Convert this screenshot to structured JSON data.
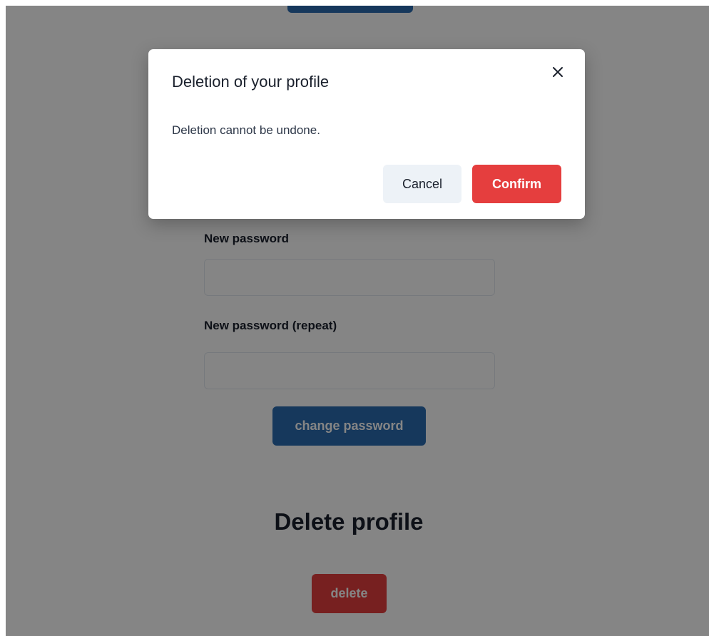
{
  "page": {
    "password_label": "New password",
    "password_repeat_label": "New password (repeat)",
    "change_password_label": "change password",
    "delete_section_title": "Delete profile",
    "delete_label": "delete"
  },
  "modal": {
    "title": "Deletion of your profile",
    "body": "Deletion cannot be undone.",
    "cancel_label": "Cancel",
    "confirm_label": "Confirm",
    "close_icon": "close-icon"
  },
  "colors": {
    "primary": "#2b6cb0",
    "danger": "#e53e3e",
    "overlay": "rgba(0,0,0,0.48)"
  }
}
